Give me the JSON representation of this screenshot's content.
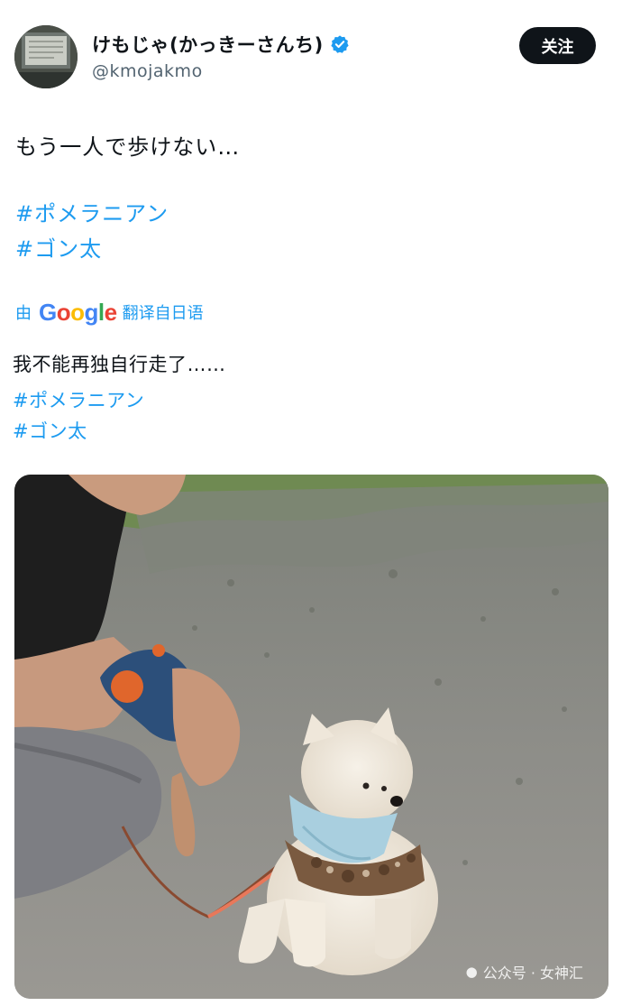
{
  "user": {
    "display_name": "けもじゃ(かっきーさんち)",
    "handle": "@kmojakmo",
    "verified": true
  },
  "follow_button": {
    "label": "关注"
  },
  "tweet": {
    "text": "もう一人で歩けない…",
    "hashtags": [
      "#ポメラニアン",
      "#ゴン太"
    ]
  },
  "translation": {
    "prefix": "由",
    "provider": "Google",
    "suffix": "翻译自日语",
    "text": "我不能再独自行走了……",
    "hashtags": [
      "#ポメラニアン",
      "#ゴン太"
    ]
  },
  "watermark": {
    "text": "公众号 · 女神汇"
  },
  "colors": {
    "link": "#1d9bf0",
    "text": "#0f1419",
    "secondary": "#536471",
    "button_bg": "#0f1419"
  }
}
